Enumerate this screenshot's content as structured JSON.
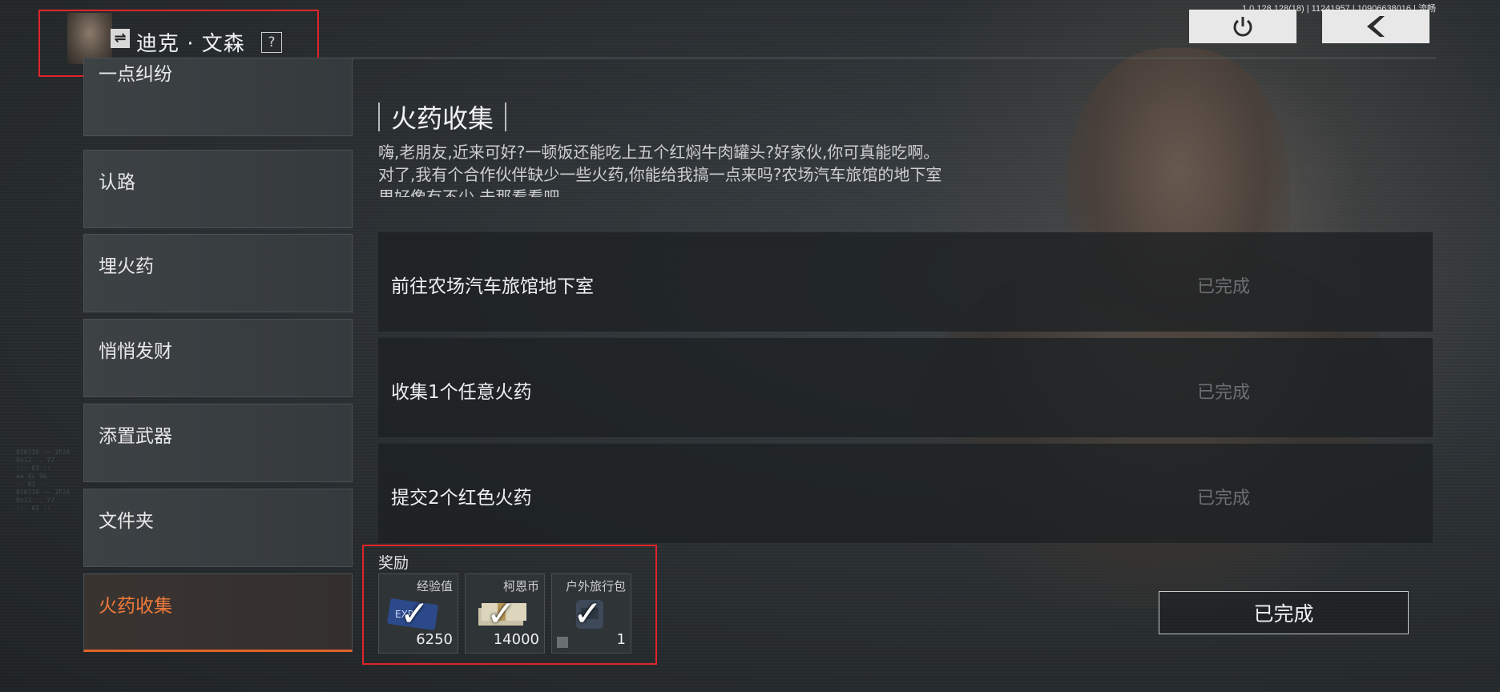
{
  "header": {
    "version": "1.0.128.128(18) | 11241957 | 10906638016 | 流畅",
    "power_icon": "power-icon",
    "back_icon": "back-chevron-icon",
    "character_name": "迪克 · 文森",
    "switch_icon": "switch-icon",
    "help_label": "?"
  },
  "sidebar": {
    "items": [
      {
        "label": "一点纠纷"
      },
      {
        "label": "认路"
      },
      {
        "label": "埋火药"
      },
      {
        "label": "悄悄发财"
      },
      {
        "label": "添置武器"
      },
      {
        "label": "文件夹"
      },
      {
        "label": "火药收集",
        "active": true
      }
    ]
  },
  "quest": {
    "title": "火药收集",
    "description": "嗨,老朋友,近来可好?一顿饭还能吃上五个红焖牛肉罐头?好家伙,你可真能吃啊。对了,我有个合作伙伴缺少一些火药,你能给我搞一点来吗?农场汽车旅馆的地下室里好像有不少,去那看看吧。",
    "tasks": [
      {
        "label": "前往农场汽车旅馆地下室",
        "status": "已完成"
      },
      {
        "label": "收集1个任意火药",
        "status": "已完成"
      },
      {
        "label": "提交2个红色火药",
        "status": "已完成"
      }
    ]
  },
  "rewards": {
    "label": "奖励",
    "items": [
      {
        "name": "经验值",
        "qty": "6250",
        "icon": "exp-card-icon"
      },
      {
        "name": "柯恩币",
        "qty": "14000",
        "icon": "money-stack-icon"
      },
      {
        "name": "户外旅行包",
        "qty": "1",
        "icon": "backpack-icon"
      }
    ]
  },
  "complete_button": "已完成",
  "colors": {
    "accent": "#f07a3a",
    "highlight_box": "#e0242a",
    "status_done": "#6c7073"
  }
}
